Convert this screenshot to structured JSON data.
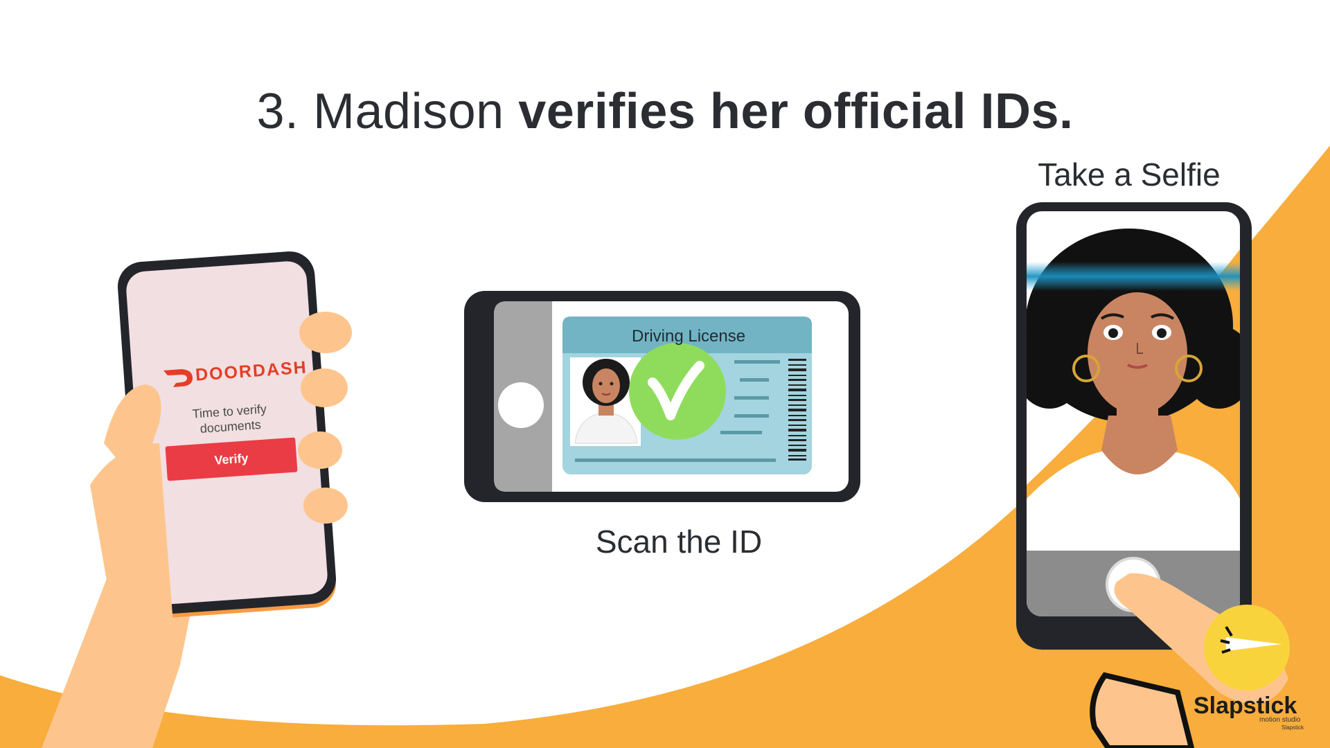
{
  "slide": {
    "title_prefix": "3. Madison ",
    "title_bold": "verifies her official IDs.",
    "scan_caption": "Scan the ID",
    "selfie_caption": "Take a Selfie"
  },
  "phone_app": {
    "brand": "DOORDASH",
    "message_line1": "Time to verify",
    "message_line2": "documents",
    "button_label": "Verify"
  },
  "id_card": {
    "title": "Driving License"
  },
  "watermark": {
    "logo": "Slapstick",
    "tagline": "motion studio",
    "small": "Slapstick"
  },
  "colors": {
    "accent_orange": "#f8ad3c",
    "skin": "#fdc58d",
    "doordash_red": "#e63d26",
    "verify_red": "#ea3c44",
    "check_green": "#8fdc5d",
    "card_blue": "#a3d4df",
    "scan_line": "#28a9d6"
  },
  "icons": [
    "check-icon",
    "shutter-button-icon",
    "doordash-logo-icon",
    "slapstick-logo-icon"
  ]
}
